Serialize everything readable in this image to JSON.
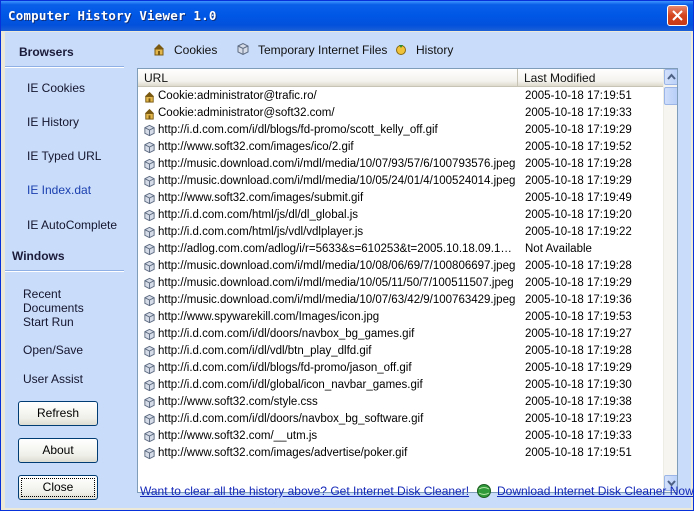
{
  "window": {
    "title": "Computer History Viewer 1.0"
  },
  "sidebar": {
    "browsers_heading": "Browsers",
    "browser_items": [
      {
        "label": "IE Cookies"
      },
      {
        "label": "IE History"
      },
      {
        "label": "IE Typed URL"
      },
      {
        "label": "IE Index.dat",
        "active": true
      },
      {
        "label": "IE AutoComplete"
      }
    ],
    "windows_heading": "Windows",
    "windows_items": [
      {
        "label": "Recent Documents"
      },
      {
        "label": "Start Run"
      },
      {
        "label": "Open/Save"
      },
      {
        "label": "User Assist"
      }
    ],
    "buttons": {
      "refresh": "Refresh",
      "about": "About",
      "close": "Close"
    }
  },
  "tabs": [
    {
      "label": "Cookies",
      "icon": "cookie-icon"
    },
    {
      "label": "Temporary Internet Files",
      "icon": "file-icon"
    },
    {
      "label": "History",
      "icon": "history-icon"
    }
  ],
  "list": {
    "columns": {
      "url": "URL",
      "modified": "Last Modified"
    },
    "rows": [
      {
        "icon": "cookie-icon",
        "url": "Cookie:administrator@trafic.ro/",
        "modified": "2005-10-18 17:19:51"
      },
      {
        "icon": "cookie-icon",
        "url": "Cookie:administrator@soft32.com/",
        "modified": "2005-10-18 17:19:33"
      },
      {
        "icon": "file-icon",
        "url": "http://i.d.com.com/i/dl/blogs/fd-promo/scott_kelly_off.gif",
        "modified": "2005-10-18 17:19:29"
      },
      {
        "icon": "file-icon",
        "url": "http://www.soft32.com/images/ico/2.gif",
        "modified": "2005-10-18 17:19:52"
      },
      {
        "icon": "file-icon",
        "url": "http://music.download.com/i/mdl/media/10/07/93/57/6/100793576.jpeg",
        "modified": "2005-10-18 17:19:28"
      },
      {
        "icon": "file-icon",
        "url": "http://music.download.com/i/mdl/media/10/05/24/01/4/100524014.jpeg",
        "modified": "2005-10-18 17:19:29"
      },
      {
        "icon": "file-icon",
        "url": "http://www.soft32.com/images/submit.gif",
        "modified": "2005-10-18 17:19:49"
      },
      {
        "icon": "file-icon",
        "url": "http://i.d.com.com/html/js/dl/dl_global.js",
        "modified": "2005-10-18 17:19:20"
      },
      {
        "icon": "file-icon",
        "url": "http://i.d.com.com/html/js/vdl/vdlplayer.js",
        "modified": "2005-10-18 17:19:22"
      },
      {
        "icon": "file-icon",
        "url": "http://adlog.com.com/adlog/i/r=5633&s=610253&t=2005.10.18.09.19.17...",
        "modified": "Not Available"
      },
      {
        "icon": "file-icon",
        "url": "http://music.download.com/i/mdl/media/10/08/06/69/7/100806697.jpeg",
        "modified": "2005-10-18 17:19:28"
      },
      {
        "icon": "file-icon",
        "url": "http://music.download.com/i/mdl/media/10/05/11/50/7/100511507.jpeg",
        "modified": "2005-10-18 17:19:29"
      },
      {
        "icon": "file-icon",
        "url": "http://music.download.com/i/mdl/media/10/07/63/42/9/100763429.jpeg",
        "modified": "2005-10-18 17:19:36"
      },
      {
        "icon": "file-icon",
        "url": "http://www.spywarekill.com/Images/icon.jpg",
        "modified": "2005-10-18 17:19:53"
      },
      {
        "icon": "file-icon",
        "url": "http://i.d.com.com/i/dl/doors/navbox_bg_games.gif",
        "modified": "2005-10-18 17:19:27"
      },
      {
        "icon": "file-icon",
        "url": "http://i.d.com.com/i/dl/vdl/btn_play_dlfd.gif",
        "modified": "2005-10-18 17:19:28"
      },
      {
        "icon": "file-icon",
        "url": "http://i.d.com.com/i/dl/blogs/fd-promo/jason_off.gif",
        "modified": "2005-10-18 17:19:29"
      },
      {
        "icon": "file-icon",
        "url": "http://i.d.com.com/i/dl/global/icon_navbar_games.gif",
        "modified": "2005-10-18 17:19:30"
      },
      {
        "icon": "file-icon",
        "url": "http://www.soft32.com/style.css",
        "modified": "2005-10-18 17:19:38"
      },
      {
        "icon": "file-icon",
        "url": "http://i.d.com.com/i/dl/doors/navbox_bg_software.gif",
        "modified": "2005-10-18 17:19:23"
      },
      {
        "icon": "file-icon",
        "url": "http://www.soft32.com/__utm.js",
        "modified": "2005-10-18 17:19:33"
      },
      {
        "icon": "file-icon",
        "url": "http://www.soft32.com/images/advertise/poker.gif",
        "modified": "2005-10-18 17:19:51"
      }
    ]
  },
  "footer": {
    "clear_link": "Want to clear all the history above? Get Internet Disk Cleaner!",
    "download_link": "Download Internet Disk Cleaner Now"
  }
}
